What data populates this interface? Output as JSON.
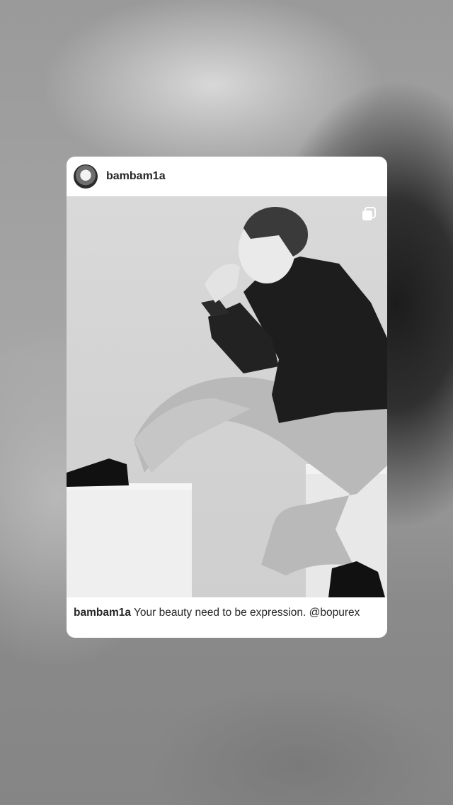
{
  "post": {
    "username": "bambam1a",
    "caption_user": "bambam1a",
    "caption_text": "Your beauty need to be expression. @bopurex"
  },
  "icons": {
    "avatar": "profile-avatar",
    "multi": "carousel-icon"
  }
}
